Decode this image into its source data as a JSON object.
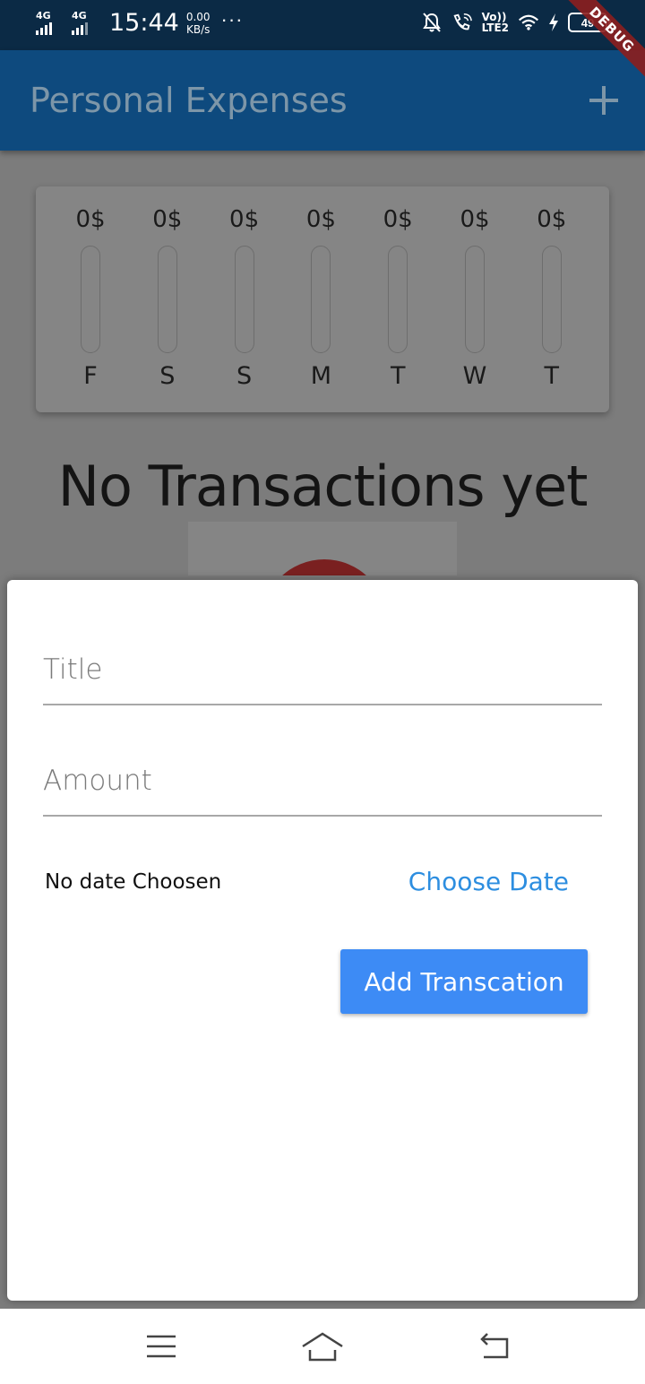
{
  "status_bar": {
    "network_1": "4G",
    "network_2": "4G",
    "time": "15:44",
    "speed_value": "0.00",
    "speed_unit": "KB/s",
    "more": "···",
    "volte_top": "Vo))",
    "volte_bottom": "LTE2",
    "battery": "49",
    "icons": [
      "mute-bell-icon",
      "wifi-calling-icon",
      "volte-icon",
      "wifi-icon",
      "charging-icon",
      "battery-icon"
    ]
  },
  "debug_banner": "DEBUG",
  "app_bar": {
    "title": "Personal Expenses",
    "add_icon": "plus-icon"
  },
  "chart": {
    "bars": [
      {
        "amount": "0$",
        "day": "F",
        "fill": 0
      },
      {
        "amount": "0$",
        "day": "S",
        "fill": 0
      },
      {
        "amount": "0$",
        "day": "S",
        "fill": 0
      },
      {
        "amount": "0$",
        "day": "M",
        "fill": 0
      },
      {
        "amount": "0$",
        "day": "T",
        "fill": 0
      },
      {
        "amount": "0$",
        "day": "W",
        "fill": 0
      },
      {
        "amount": "0$",
        "day": "T",
        "fill": 0
      }
    ]
  },
  "empty_state": {
    "message": "No Transactions yet"
  },
  "form": {
    "title_placeholder": "Title",
    "title_value": "",
    "amount_placeholder": "Amount",
    "amount_value": "",
    "date_status": "No date Choosen",
    "choose_date_label": "Choose Date",
    "submit_label": "Add Transcation"
  },
  "nav_bar": {
    "items": [
      "menu-icon",
      "home-icon",
      "back-icon"
    ]
  },
  "colors": {
    "app_bar": "#0e4a7e",
    "status_bar": "#0b2a45",
    "accent_link": "#2d8ee0",
    "button": "#3d8bf5"
  }
}
